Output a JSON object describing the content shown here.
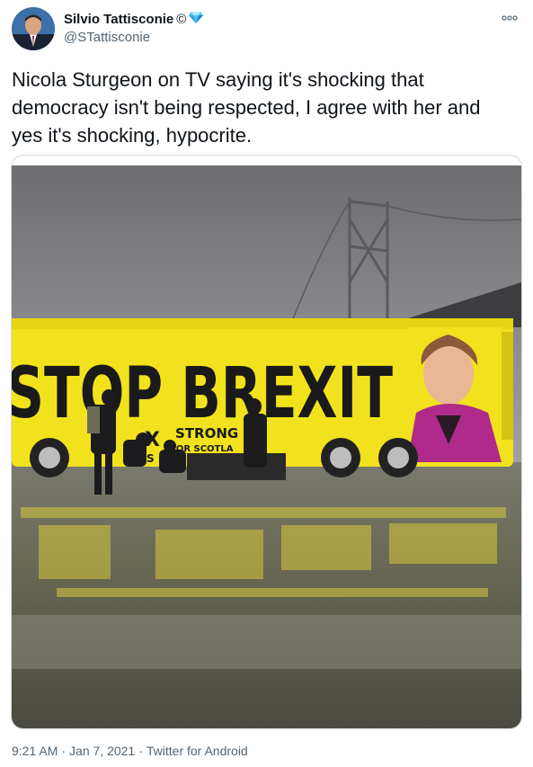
{
  "author": {
    "display_name": "Silvio Tattisconie",
    "name_suffix": "©",
    "badge_icon": "diamond-icon",
    "handle": "@STattisconie",
    "avatar_colors": {
      "background": "#3d6fa8",
      "suit": "#1b2233",
      "skin": "#d9a47f"
    }
  },
  "tweet": {
    "text": "Nicola Sturgeon on TV saying it's shocking that democracy isn't being respected, I agree with her and yes it's shocking, hypocrite."
  },
  "media": {
    "bus_slogan": "STOP BREXIT",
    "bus_subtext_1": "STRONG",
    "bus_subtext_2": "FOR SCOTLA",
    "bus_partial_letter": "S",
    "bus_cross": "X",
    "colors": {
      "bus": "#f2e21d",
      "sky": "#8a8a8c",
      "ground": "#4a4a42",
      "jacket": "#b02a8c"
    }
  },
  "footer": {
    "time": "9:21 AM",
    "separator": "·",
    "date": "Jan 7, 2021",
    "source": "Twitter for Android"
  },
  "icons": {
    "more": "more-options-icon"
  }
}
